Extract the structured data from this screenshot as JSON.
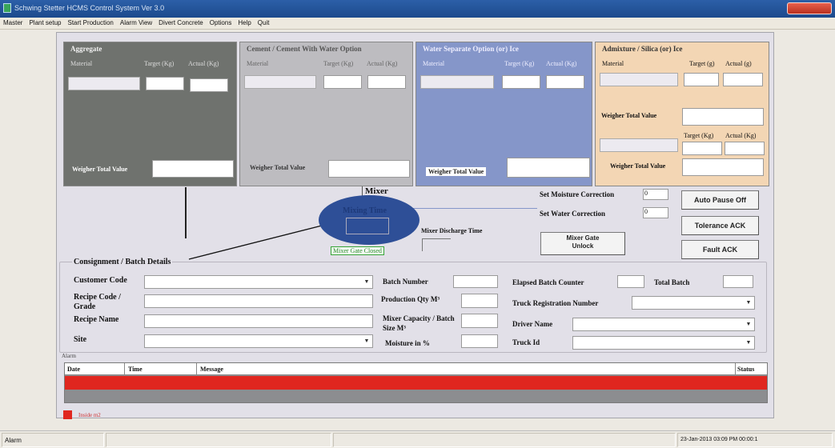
{
  "window": {
    "title": "Schwing Stetter HCMS Control System Ver 3.0"
  },
  "menu": [
    "Master",
    "Plant setup",
    "Start Production",
    "Alarm View",
    "Divert Concrete",
    "Options",
    "Help",
    "Quit"
  ],
  "aggregate": {
    "title": "Aggregate",
    "material": "Material",
    "target": "Target (Kg)",
    "actual": "Actual (Kg)",
    "weigher": "Weigher Total Value"
  },
  "cement": {
    "title": "Cement / Cement With Water Option",
    "material": "Material",
    "target": "Target (Kg)",
    "actual": "Actual (Kg)",
    "weigher": "Weigher Total Value"
  },
  "water": {
    "title": "Water Separate Option (or) Ice",
    "material": "Material",
    "target": "Target (Kg)",
    "actual": "Actual (Kg)",
    "weigher": "Weigher Total Value"
  },
  "admixture": {
    "title": "Admixture / Silica (or) Ice",
    "material": "Material",
    "target": "Target (g)",
    "actual": "Actual (g)",
    "weigher1": "Weigher Total Value",
    "target2": "Target (Kg)",
    "actual2": "Actual (Kg)",
    "weigher2": "Weigher Total Value"
  },
  "mixer": {
    "title": "Mixer",
    "mixing_time": "Mixing Time",
    "discharge": "Mixer Discharge Time",
    "gate_closed": "Mixer Gate Closed",
    "gate_unlock": "Mixer Gate Unlock"
  },
  "corrections": {
    "moisture_label": "Set Moisture Correction",
    "moisture_value": "0",
    "water_label": "Set Water Correction",
    "water_value": "0"
  },
  "buttons": {
    "auto_pause": "Auto Pause Off",
    "tolerance": "Tolerance ACK",
    "fault": "Fault ACK"
  },
  "consignment": {
    "title": "Consignment / Batch Details",
    "customer_code": "Customer Code",
    "recipe_code": "Recipe Code / Grade",
    "recipe_name": "Recipe Name",
    "site": "Site",
    "batch_number": "Batch Number",
    "production_qty": "Production Qty M³",
    "mixer_capacity": "Mixer Capacity / Batch Size M³",
    "moisture": "Moisture in %",
    "elapsed": "Elapsed Batch Counter",
    "total_batch": "Total Batch",
    "truck_reg": "Truck Registration Number",
    "driver": "Driver Name",
    "truck_id": "Truck Id"
  },
  "alarm": {
    "title": "Alarm",
    "columns": [
      "Date",
      "Time",
      "Message",
      "Status"
    ],
    "legend": "Inside m2"
  },
  "statusbar": {
    "left": "Alarm",
    "datetime": "23-Jan-2013 03:09 PM 00:00:1"
  },
  "colors": {
    "aggregate": "#6f726e",
    "cement": "#bdbcc0",
    "water": "#8596c9",
    "admixture": "#f3d6b4",
    "alarm_row": "#e0261f",
    "mixer_ellipse": "#2e4f97"
  }
}
